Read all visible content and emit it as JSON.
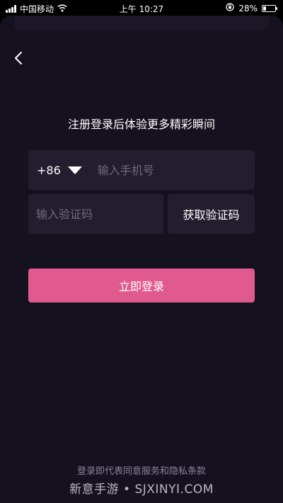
{
  "status_bar": {
    "carrier": "中国移动",
    "time": "上午 10:27",
    "battery_percent": "28%",
    "battery_level": 0.28,
    "signal_icon": "signal-bars-icon",
    "wifi_icon": "wifi-icon",
    "orientation_lock_icon": "orientation-lock-icon",
    "battery_icon": "battery-icon"
  },
  "nav": {
    "back_icon": "chevron-left-icon"
  },
  "heading": "注册登录后体验更多精彩瞬间",
  "phone": {
    "country_code": "+86",
    "dropdown_icon": "triangle-down-icon",
    "placeholder": "输入手机号"
  },
  "verification": {
    "placeholder": "输入验证码",
    "get_code_label": "获取验证码"
  },
  "login_button_label": "立即登录",
  "terms_text": "登录即代表同意服务和隐私条款",
  "watermark": "新意手游 • SJXINYI.COM",
  "colors": {
    "background": "#15111f",
    "field_background": "#221e2e",
    "accent": "#e05a8d",
    "placeholder_text": "#6f6a7c",
    "muted_text": "#8a8596"
  }
}
